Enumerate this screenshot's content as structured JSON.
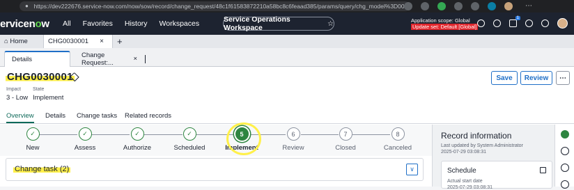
{
  "browser": {
    "url": "https://dev222676.service-now.com/now/sow/record/change_request/48c1f61583872210a58bc8c6feaad385/params/query/chg_model%3D007c4001..."
  },
  "header": {
    "logo_prefix": "ervicen",
    "logo_o": "o",
    "logo_suffix": "w",
    "nav": [
      "All",
      "Favorites",
      "History",
      "Workspaces"
    ],
    "workspace": "Service Operations Workspace",
    "scope": "Application scope: Global",
    "update_set": "Update set: Default [Global]",
    "badge_count": "1"
  },
  "tab_strip": {
    "home": "Home",
    "record": "CHG0030001",
    "plus": "+"
  },
  "sub_tabs": {
    "details": "Details",
    "change_request": "Change Request:..."
  },
  "record": {
    "number": "CHG0030001",
    "fields": [
      {
        "label": "Impact",
        "value": "3 - Low"
      },
      {
        "label": "State",
        "value": "Implement"
      }
    ],
    "buttons": {
      "save": "Save",
      "review": "Review",
      "more": "⋯"
    },
    "tabs": [
      "Overview",
      "Details",
      "Change tasks",
      "Related records"
    ]
  },
  "stepper": {
    "steps": [
      {
        "label": "New",
        "status": "done",
        "symbol": "✓"
      },
      {
        "label": "Assess",
        "status": "done",
        "symbol": "✓"
      },
      {
        "label": "Authorize",
        "status": "done",
        "symbol": "✓"
      },
      {
        "label": "Scheduled",
        "status": "done",
        "symbol": "✓"
      },
      {
        "label": "Implement",
        "status": "current",
        "symbol": "5"
      },
      {
        "label": "Review",
        "status": "pending",
        "symbol": "6"
      },
      {
        "label": "Closed",
        "status": "pending",
        "symbol": "7"
      },
      {
        "label": "Canceled",
        "status": "pending",
        "symbol": "8"
      }
    ]
  },
  "change_task": {
    "title": "Change task (2)"
  },
  "side_panel": {
    "title": "Record information",
    "updated_by": "Last updated by System Administrator",
    "updated_at": "2025-07-29 03:08:31",
    "schedule_title": "Schedule",
    "actual_start_label": "Actual start date",
    "actual_start_value": "2025-07-29 03:08:31"
  },
  "colors": {
    "header_bg": "#1d2330",
    "accent_green": "#2e8540",
    "brand_blue": "#1f6fc7",
    "highlight_yellow": "#fff04a",
    "update_set_red": "#e1262d"
  }
}
